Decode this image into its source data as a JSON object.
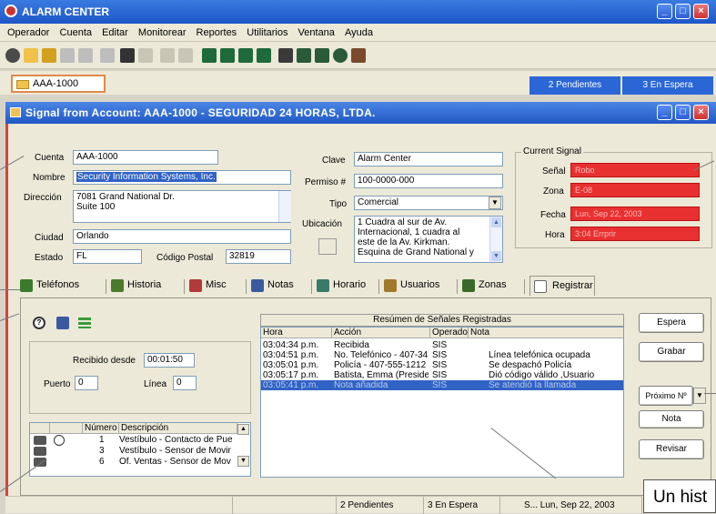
{
  "app": {
    "title": "ALARM CENTER",
    "menu": [
      "Operador",
      "Cuenta",
      "Editar",
      "Monitorear",
      "Reportes",
      "Utilitarios",
      "Ventana",
      "Ayuda"
    ],
    "account_tab": "AAA-1000",
    "pending_top": "2 Pendientes",
    "waiting_top": "3 En Espera"
  },
  "signal_window": {
    "title": "Signal from Account: AAA-1000  -  SEGURIDAD 24 HORAS, LTDA."
  },
  "account": {
    "cuenta_label": "Cuenta",
    "cuenta": "AAA-1000",
    "nombre_label": "Nombre",
    "nombre": "Security Information Systems, Inc.",
    "direccion_label": "Dirección",
    "direccion_1": "7081 Grand National Dr.",
    "direccion_2": "Suite 100",
    "ciudad_label": "Ciudad",
    "ciudad": "Orlando",
    "estado_label": "Estado",
    "estado": "FL",
    "cp_label": "Código Postal",
    "codigo_postal": "32819",
    "clave_label": "Clave",
    "clave": "Alarm Center",
    "permiso_label": "Permiso #",
    "permiso": "100-0000-000",
    "tipo_label": "Tipo",
    "tipo": "Comercial",
    "ubicacion_label": "Ubicación",
    "ubicacion_lines": [
      "1 Cuadra al sur de Av.",
      "Internacional, 1 cuadra al",
      "este de la Av. Kirkman.",
      "Esquina de Grand National y"
    ]
  },
  "current_signal": {
    "legend": "Current Signal",
    "senal_label": "Señal",
    "senal": "Robo",
    "zona_label": "Zona",
    "zona": "E-08",
    "fecha_label": "Fecha",
    "fecha": "Lun, Sep 22, 2003",
    "hora_label": "Hora",
    "hora": "3:04 Errprir"
  },
  "tabs": [
    {
      "label": "Teléfonos",
      "color": "#3b7a2a"
    },
    {
      "label": "Historia",
      "color": "#4a7a2a"
    },
    {
      "label": "Misc",
      "color": "#b23a3a"
    },
    {
      "label": "Notas",
      "color": "#3a5aa0"
    },
    {
      "label": "Horario",
      "color": "#3a7a6a"
    },
    {
      "label": "Usuarios",
      "color": "#a07a2a"
    },
    {
      "label": "Zonas",
      "color": "#3a6a2a"
    },
    {
      "label": "Registrar",
      "color": "#666666"
    }
  ],
  "registrar": {
    "recibido_label": "Recibido desde",
    "recibido": "00:01:50",
    "puerto_label": "Puerto",
    "puerto": "0",
    "linea_label": "Línea",
    "linea": "0",
    "zones_headers": [
      "Número",
      "Descripción"
    ],
    "zones": [
      {
        "num": "1",
        "desc": "Vestíbulo - Contacto de Pue"
      },
      {
        "num": "3",
        "desc": "Vestíbulo - Sensor de Movir"
      },
      {
        "num": "6",
        "desc": "Of. Ventas - Sensor de Mov"
      }
    ],
    "summary_title": "Resúmen de Señales Registradas",
    "log_headers": [
      "Hora",
      "Acción",
      "Operado",
      "Nota"
    ],
    "log": [
      {
        "hora": "03:04:34 p.m.",
        "accion": "Recibida",
        "op": "SIS",
        "nota": ""
      },
      {
        "hora": "03:04:51 p.m.",
        "accion": "No. Telefónico  - 407-345",
        "op": "SIS",
        "nota": "Línea telefónica ocupada"
      },
      {
        "hora": "03:05:01 p.m.",
        "accion": "Policía - 407-555-1212",
        "op": "SIS",
        "nota": "Se despachó Policía"
      },
      {
        "hora": "03:05:17 p.m.",
        "accion": "Batista, Emma (Presidente",
        "op": "SIS",
        "nota": "Dió código válido ,Usuario"
      },
      {
        "hora": "03:05:41 p.m.",
        "accion": "Nota añadida",
        "op": "SIS",
        "nota": "Se atendió la llamada"
      }
    ]
  },
  "buttons": {
    "espera": "Espera",
    "grabar": "Grabar",
    "proximo": "Próximo Nº",
    "nota": "Nota",
    "revisar": "Revisar"
  },
  "status": {
    "pendientes": "2 Pendientes",
    "en_espera": "3 En Espera",
    "date": "S...  Lun, Sep 22, 2003"
  },
  "callout": "Un hist"
}
